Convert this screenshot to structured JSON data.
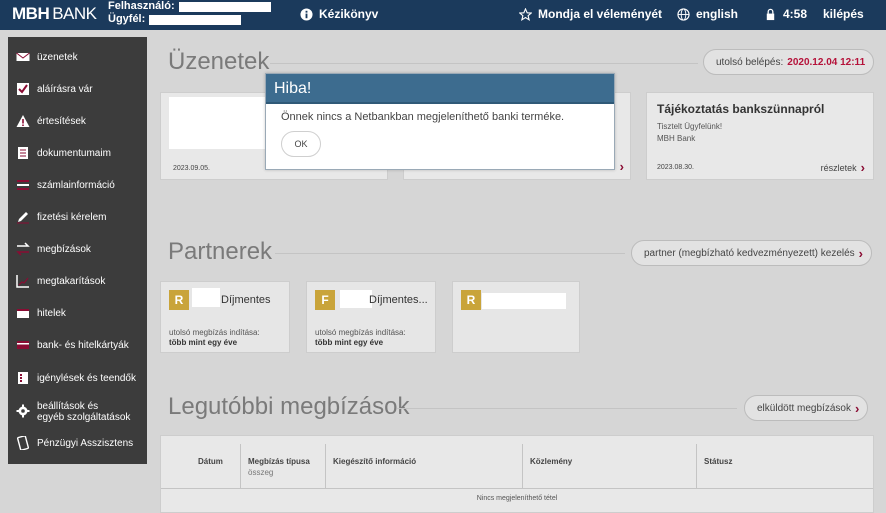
{
  "header": {
    "logo_main": "MBH",
    "logo_sub": "BANK",
    "user_label": "Felhasználó:",
    "client_label": "Ügyfél:",
    "help_label": "Kézikönyv",
    "feedback_label": "Mondja el véleményét",
    "language_label": "english",
    "timer_value": "4:58",
    "logout_label": "kilépés"
  },
  "sidebar": {
    "items": [
      {
        "label": "üzenetek",
        "icon": "mail-icon"
      },
      {
        "label": "aláírásra vár",
        "icon": "checkbox-icon"
      },
      {
        "label": "értesítések",
        "icon": "warning-icon"
      },
      {
        "label": "dokumentumaim",
        "icon": "document-icon"
      },
      {
        "label": "számlainformáció",
        "icon": "account-icon"
      },
      {
        "label": "fizetési kérelem",
        "icon": "pen-icon"
      },
      {
        "label": "megbízások",
        "icon": "transfer-icon"
      },
      {
        "label": "megtakarítások",
        "icon": "chart-icon"
      },
      {
        "label": "hitelek",
        "icon": "loan-icon"
      },
      {
        "label": "bank- és hitelkártyák",
        "icon": "card-icon"
      },
      {
        "label": "igénylések és teendők",
        "icon": "list-icon"
      },
      {
        "label": "beállítások és",
        "label2": "egyéb szolgáltatások",
        "icon": "gear-icon"
      },
      {
        "label": "Pénzügyi Asszisztens",
        "icon": "phone-icon"
      }
    ]
  },
  "messages": {
    "title": "Üzenetek",
    "last_login_label": "utolsó belépés:",
    "last_login_value": "2020.12.04 12:11",
    "cards": [
      {
        "date": "2023.09.05."
      },
      {
        "date": ""
      },
      {
        "title": "Tájékoztatás bankszünnapról",
        "line1": "Tisztelt Ügyfelünk!",
        "line2": "MBH Bank",
        "date": "2023.08.30.",
        "link": "részletek"
      }
    ]
  },
  "partners": {
    "title": "Partnerek",
    "manage_label": "partner (megbízható kedvezményezett) kezelés",
    "items": [
      {
        "badge": "R",
        "name": "Díjmentes",
        "meta_label": "utolsó megbízás indítása:",
        "meta_value": "több mint egy éve"
      },
      {
        "badge": "F",
        "name": "Díjmentes...",
        "meta_label": "utolsó megbízás indítása:",
        "meta_value": "több mint egy éve"
      },
      {
        "badge": "R",
        "name": "",
        "meta_label": "",
        "meta_value": ""
      }
    ]
  },
  "orders": {
    "title": "Legutóbbi megbízások",
    "sent_label": "elküldött megbízások",
    "columns": [
      "Dátum",
      "Megbízás típusa",
      "Kiegészítő információ",
      "Közlemény",
      "Státusz"
    ],
    "column_sub": "összeg",
    "empty_text": "Nincs megjeleníthető tétel"
  },
  "modal": {
    "title": "Hiba!",
    "message": "Önnek nincs a Netbankban megjeleníthető banki terméke.",
    "ok_label": "OK"
  },
  "colors": {
    "header_bg": "#1b3a5c",
    "sidebar_bg": "#3c3c3c",
    "accent_red": "#b5123a",
    "badge_gold": "#c9a43a",
    "modal_head": "#3d6c8f"
  }
}
